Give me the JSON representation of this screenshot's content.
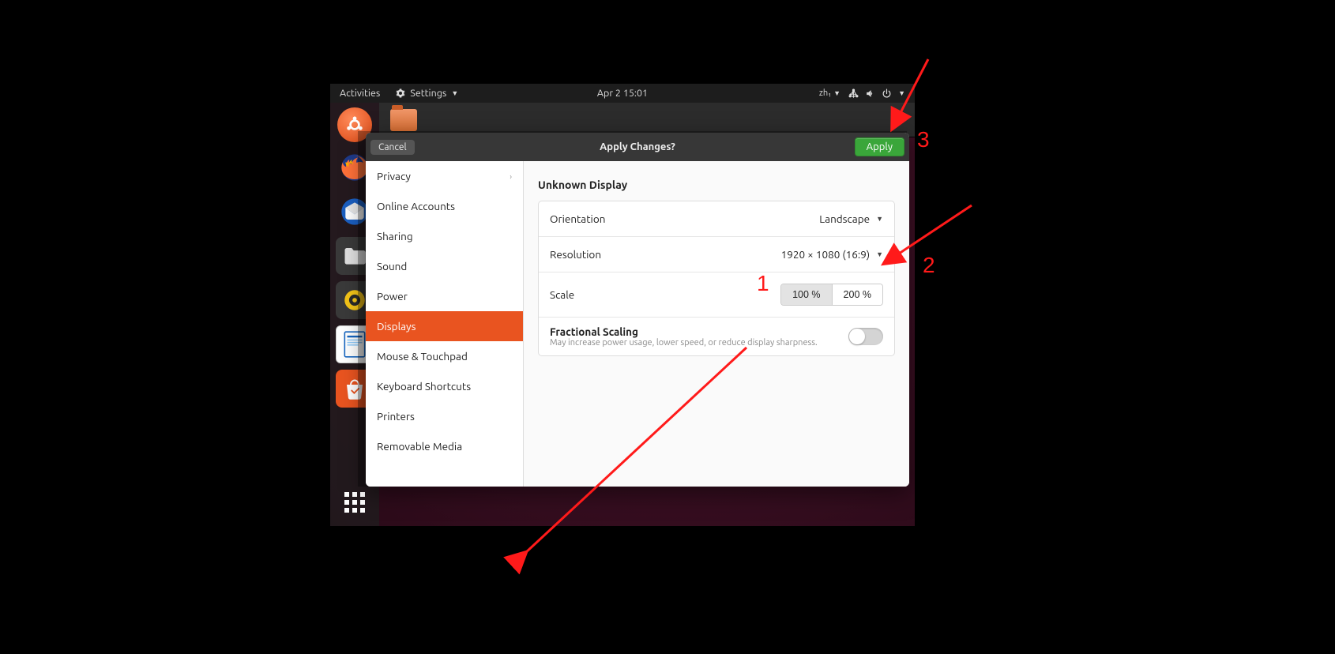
{
  "panel": {
    "activities": "Activities",
    "app_name": "Settings",
    "clock": "Apr 2  15:01",
    "ime": "zh₁"
  },
  "nautilus": {
    "icon": "folder"
  },
  "dialog": {
    "cancel": "Cancel",
    "title": "Apply Changes?",
    "apply": "Apply"
  },
  "sidebar": {
    "items": [
      {
        "label": "Privacy",
        "chevron": true
      },
      {
        "label": "Online Accounts"
      },
      {
        "label": "Sharing"
      },
      {
        "label": "Sound"
      },
      {
        "label": "Power"
      },
      {
        "label": "Displays",
        "selected": true
      },
      {
        "label": "Mouse & Touchpad"
      },
      {
        "label": "Keyboard Shortcuts"
      },
      {
        "label": "Printers"
      },
      {
        "label": "Removable Media"
      }
    ]
  },
  "displays": {
    "section": "Unknown Display",
    "orientation_label": "Orientation",
    "orientation_value": "Landscape",
    "resolution_label": "Resolution",
    "resolution_value": "1920 × 1080 (16:9)",
    "scale_label": "Scale",
    "scale_options": [
      "100 %",
      "200 %"
    ],
    "scale_selected": 0,
    "fractional_label": "Fractional Scaling",
    "fractional_hint": "May increase power usage, lower speed, or reduce display sharpness.",
    "fractional_on": false
  },
  "annotations": {
    "n1": "1",
    "n2": "2",
    "n3": "3"
  }
}
